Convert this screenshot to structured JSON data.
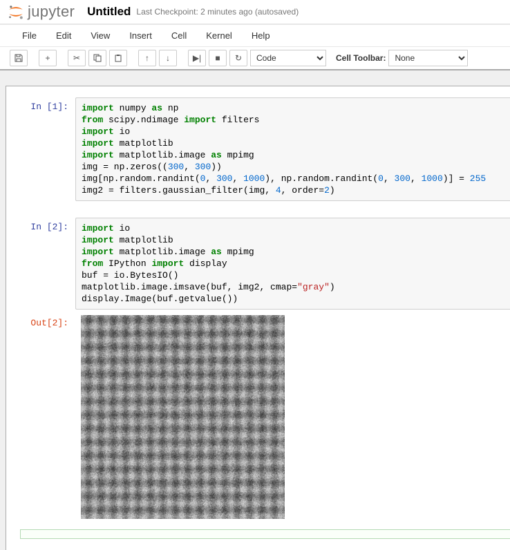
{
  "header": {
    "logo_text": "jupyter",
    "title": "Untitled",
    "checkpoint": "Last Checkpoint: 2 minutes ago (autosaved)"
  },
  "menubar": [
    "File",
    "Edit",
    "View",
    "Insert",
    "Cell",
    "Kernel",
    "Help"
  ],
  "toolbar": {
    "cell_type_selected": "Code",
    "cell_toolbar_label": "Cell Toolbar:",
    "cell_toolbar_selected": "None"
  },
  "cells": [
    {
      "prompt": "In [1]:",
      "tokens": [
        {
          "t": "import",
          "c": "kw"
        },
        {
          "t": " numpy "
        },
        {
          "t": "as",
          "c": "kw"
        },
        {
          "t": " np\n"
        },
        {
          "t": "from",
          "c": "kw"
        },
        {
          "t": " scipy.ndimage "
        },
        {
          "t": "import",
          "c": "kw"
        },
        {
          "t": " filters\n"
        },
        {
          "t": "import",
          "c": "kw"
        },
        {
          "t": " io\n"
        },
        {
          "t": "import",
          "c": "kw"
        },
        {
          "t": " matplotlib\n"
        },
        {
          "t": "import",
          "c": "kw"
        },
        {
          "t": " matplotlib.image "
        },
        {
          "t": "as",
          "c": "kw"
        },
        {
          "t": " mpimg\n"
        },
        {
          "t": "img = np.zeros(("
        },
        {
          "t": "300",
          "c": "num"
        },
        {
          "t": ", "
        },
        {
          "t": "300",
          "c": "num"
        },
        {
          "t": "))\n"
        },
        {
          "t": "img[np.random.randint("
        },
        {
          "t": "0",
          "c": "num"
        },
        {
          "t": ", "
        },
        {
          "t": "300",
          "c": "num"
        },
        {
          "t": ", "
        },
        {
          "t": "1000",
          "c": "num"
        },
        {
          "t": "), np.random.randint("
        },
        {
          "t": "0",
          "c": "num"
        },
        {
          "t": ", "
        },
        {
          "t": "300",
          "c": "num"
        },
        {
          "t": ", "
        },
        {
          "t": "1000",
          "c": "num"
        },
        {
          "t": ")] = "
        },
        {
          "t": "255",
          "c": "num"
        },
        {
          "t": "\n"
        },
        {
          "t": "img2 = filters.gaussian_filter(img, "
        },
        {
          "t": "4",
          "c": "num"
        },
        {
          "t": ", order="
        },
        {
          "t": "2",
          "c": "num"
        },
        {
          "t": ")"
        }
      ]
    },
    {
      "prompt": "In [2]:",
      "tokens": [
        {
          "t": "import",
          "c": "kw"
        },
        {
          "t": " io\n"
        },
        {
          "t": "import",
          "c": "kw"
        },
        {
          "t": " matplotlib\n"
        },
        {
          "t": "import",
          "c": "kw"
        },
        {
          "t": " matplotlib.image "
        },
        {
          "t": "as",
          "c": "kw"
        },
        {
          "t": " mpimg\n"
        },
        {
          "t": "from",
          "c": "kw"
        },
        {
          "t": " IPython "
        },
        {
          "t": "import",
          "c": "kw"
        },
        {
          "t": " display\n"
        },
        {
          "t": "buf = io.BytesIO()\n"
        },
        {
          "t": "matplotlib.image.imsave(buf, img2, cmap="
        },
        {
          "t": "\"gray\"",
          "c": "str"
        },
        {
          "t": ")\n"
        },
        {
          "t": "display.Image(buf.getvalue())"
        }
      ]
    }
  ],
  "output": {
    "prompt": "Out[2]:"
  }
}
